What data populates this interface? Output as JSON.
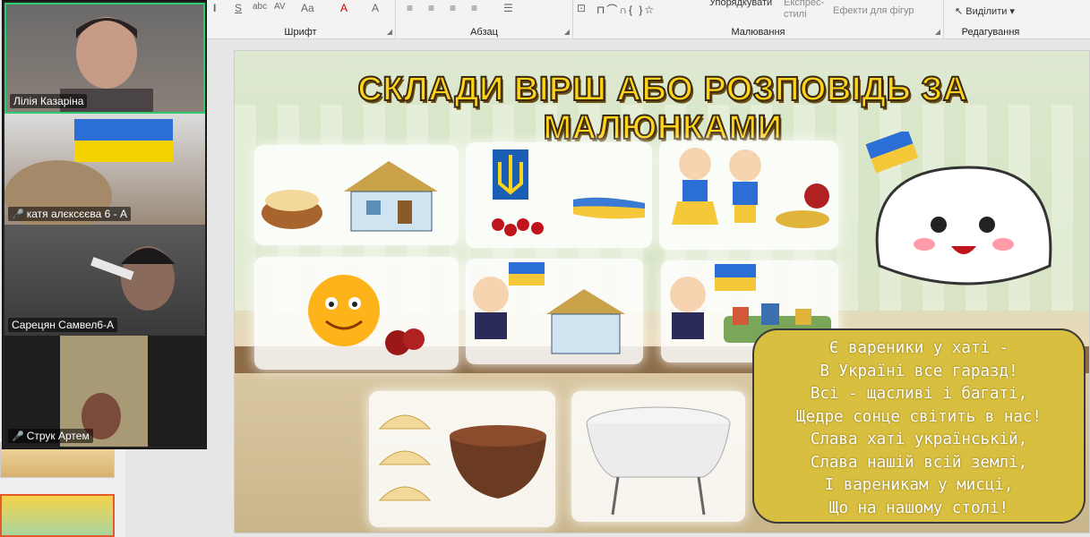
{
  "ribbon": {
    "groups": {
      "font": "Шрифт",
      "paragraph": "Абзац",
      "drawing": "Малювання",
      "editing": "Редагування"
    },
    "arrange_label": "Упорядкувати",
    "quick_styles_label": "Експрес-стилі",
    "shape_effects_label": "Ефекти для фігур",
    "select_label": "Виділити"
  },
  "slide": {
    "title": "СКЛАДИ ВІРШ АБО РОЗПОВІДЬ ЗА МАЛЮНКАМИ",
    "poem_lines": [
      "Є вареники у хаті -",
      "В Україні все гаразд!",
      "Всі - щасливі і багаті,",
      "Щедре сонце світить в нас!",
      "Слава хаті українській,",
      "Слава нашій всій землі,",
      "І вареникам у мисці,",
      "Що на нашому столі!"
    ]
  },
  "participants": [
    {
      "name": "Лілія Казаріна",
      "muted": false,
      "active": true
    },
    {
      "name": "катя алєксєєва 6 - А",
      "muted": true,
      "active": false
    },
    {
      "name": "Сарецян Самвел6-А",
      "muted": false,
      "active": false
    },
    {
      "name": "Струк Артем",
      "muted": true,
      "active": false
    }
  ],
  "colors": {
    "title_fill": "#ffd319",
    "poem_box": "#d8bf3f",
    "active_speaker": "#2ecc71",
    "muted_mic": "#ff4a4a"
  }
}
